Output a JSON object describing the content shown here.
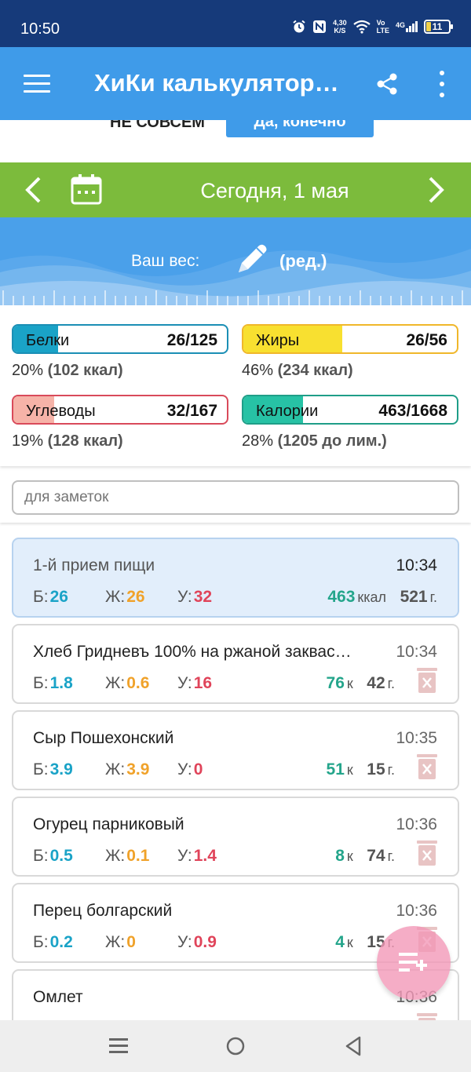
{
  "status_bar": {
    "time": "10:50",
    "net_speed_value": "4,30",
    "net_speed_unit": "K/S",
    "lte_top": "Vo",
    "lte_bottom": "LTE",
    "signal_label": "4G",
    "battery": "11"
  },
  "app_bar": {
    "title": "ХиКи калькулятор…"
  },
  "prompt": {
    "no_label": "Не совсем",
    "yes_label": "Да, конечно"
  },
  "date_nav": {
    "date_label": "Сегодня, 1 мая"
  },
  "weight": {
    "label": "Ваш вес:",
    "edit_label": "(ред.)"
  },
  "stats": {
    "protein": {
      "name": "Белки",
      "value": "26/125",
      "fraction": 0.208,
      "summary_pct": "20%",
      "summary_detail": "(102 ккал)"
    },
    "fat": {
      "name": "Жиры",
      "value": "26/56",
      "fraction": 0.464,
      "summary_pct": "46%",
      "summary_detail": "(234 ккал)"
    },
    "carbs": {
      "name": "Углеводы",
      "value": "32/167",
      "fraction": 0.192,
      "summary_pct": "19%",
      "summary_detail": "(128 ккал)"
    },
    "calories": {
      "name": "Калории",
      "value": "463/1668",
      "fraction": 0.278,
      "summary_pct": "28%",
      "summary_detail": "(1205 до лим.)"
    }
  },
  "notes": {
    "placeholder": "для заметок"
  },
  "labels": {
    "protein_short": "Б:",
    "fat_short": "Ж:",
    "carbs_short": "У:",
    "kcal_unit": "ккал",
    "k_unit": "к",
    "gram_unit": "г."
  },
  "meal": {
    "name": "1-й прием пищи",
    "time": "10:34",
    "protein": "26",
    "fat": "26",
    "carbs": "32",
    "kcal": "463",
    "grams": "521"
  },
  "items": [
    {
      "name": "Хлеб Гридневъ 100% на ржаной заквас…",
      "time": "10:34",
      "protein": "1.8",
      "fat": "0.6",
      "carbs": "16",
      "kcal": "76",
      "grams": "42"
    },
    {
      "name": "Сыр Пошехонский",
      "time": "10:35",
      "protein": "3.9",
      "fat": "3.9",
      "carbs": "0",
      "kcal": "51",
      "grams": "15"
    },
    {
      "name": "Огурец парниковый",
      "time": "10:36",
      "protein": "0.5",
      "fat": "0.1",
      "carbs": "1.4",
      "kcal": "8",
      "grams": "74"
    },
    {
      "name": "Перец болгарский",
      "time": "10:36",
      "protein": "0.2",
      "fat": "0",
      "carbs": "0.9",
      "kcal": "4",
      "grams": "15"
    },
    {
      "name": "Омлет",
      "time": "10:36"
    }
  ],
  "colors": {
    "app_bar": "#3f9be9",
    "date_bar": "#7cbb3c",
    "protein": "#1aa3c7",
    "fat": "#f0a22a",
    "carbs": "#e0445a",
    "kcal": "#24a58b",
    "fab": "#f296b6"
  }
}
